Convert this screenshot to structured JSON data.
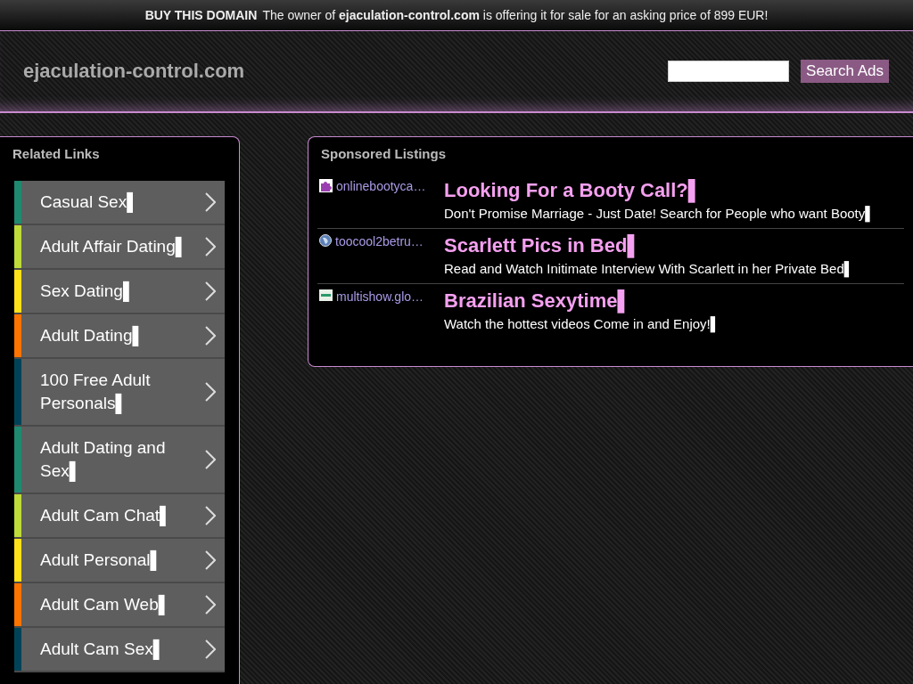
{
  "banner": {
    "label": "BUY THIS DOMAIN",
    "message": "The owner of **ejaculation-control.com** is offering it for sale for an asking price of 899 EUR!"
  },
  "header": {
    "site_name": "ejaculation-control.com",
    "search_button": "Search Ads"
  },
  "related_links": {
    "title": "Related Links",
    "items": [
      {
        "label": "Casual Sex▌",
        "color": "#1f8a70"
      },
      {
        "label": "Adult Affair Dating▌",
        "color": "#bedb39"
      },
      {
        "label": "Sex Dating▌",
        "color": "#ffe11a"
      },
      {
        "label": "Adult Dating▌",
        "color": "#fd7400"
      },
      {
        "label": "100 Free Adult Personals▌",
        "color": "#004358"
      },
      {
        "label": "Adult Dating and Sex▌",
        "color": "#1f8a70"
      },
      {
        "label": "Adult Cam Chat▌",
        "color": "#bedb39"
      },
      {
        "label": "Adult Personal▌",
        "color": "#ffe11a"
      },
      {
        "label": "Adult Cam Web▌",
        "color": "#fd7400"
      },
      {
        "label": "Adult Cam Sex▌",
        "color": "#004358"
      }
    ]
  },
  "sponsored_listings": {
    "title": "Sponsored Listings",
    "items": [
      {
        "kind": "puzzle",
        "domain": "onlinebootyca…",
        "headline": "Looking For a Booty Call?▌",
        "description": "Don't Promise Marriage - Just Date! Search for People who want Booty▌"
      },
      {
        "kind": "globe",
        "domain": "toocool2betru…",
        "headline": "Scarlett Pics in Bed▌",
        "description": "Read and Watch Initimate Interview With Scarlett in her Private Bed▌"
      },
      {
        "kind": "tile",
        "domain": "multishow.glo…",
        "headline": "Brazilian Sexytime▌",
        "description": "Watch the hottest videos Come in and Enjoy!▌"
      }
    ]
  }
}
